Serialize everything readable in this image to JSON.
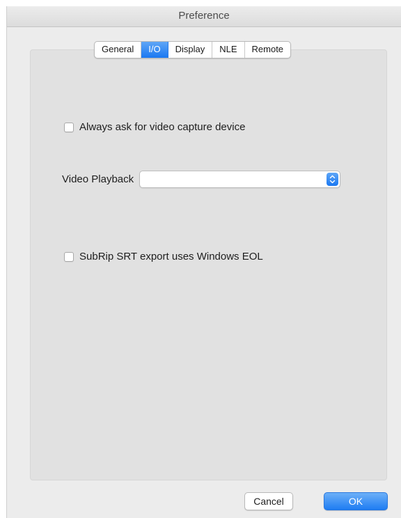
{
  "window": {
    "title": "Preference"
  },
  "tabs": {
    "items": [
      {
        "label": "General",
        "active": false
      },
      {
        "label": "I/O",
        "active": true
      },
      {
        "label": "Display",
        "active": false
      },
      {
        "label": "NLE",
        "active": false
      },
      {
        "label": "Remote",
        "active": false
      }
    ]
  },
  "io": {
    "always_ask_capture": {
      "label": "Always ask for video capture device",
      "checked": false
    },
    "video_playback": {
      "label": "Video Playback",
      "value": ""
    },
    "srt_windows_eol": {
      "label": "SubRip SRT export uses Windows EOL",
      "checked": false
    }
  },
  "footer": {
    "cancel_label": "Cancel",
    "ok_label": "OK"
  },
  "colors": {
    "accent": "#1a78f2",
    "window_bg": "#ececec",
    "panel_bg": "#e1e1e1"
  },
  "icons": {
    "select_arrows": "chevron-up-down-icon"
  }
}
